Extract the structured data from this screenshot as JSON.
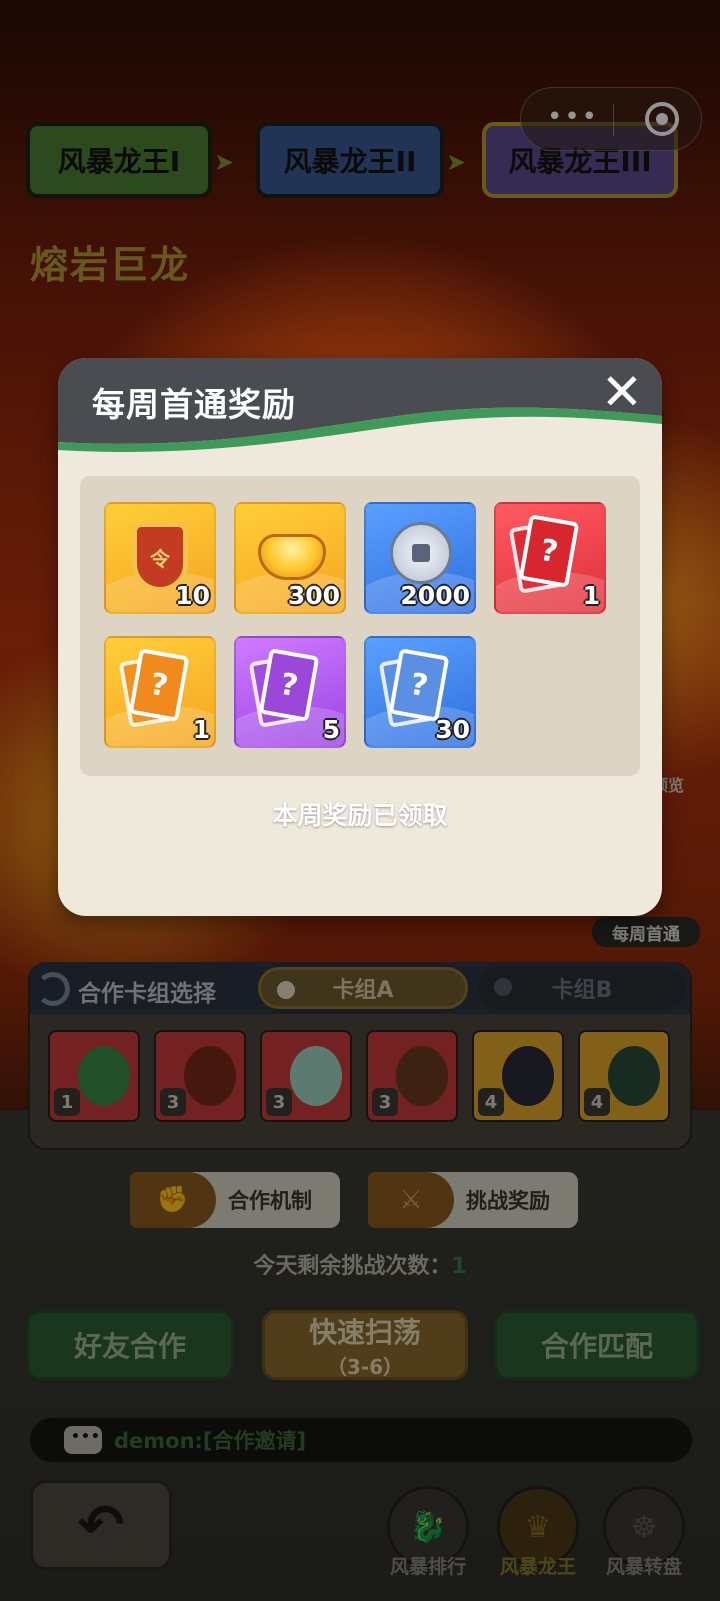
{
  "stages": [
    "风暴龙王I",
    "风暴龙王II",
    "风暴龙王III"
  ],
  "boss_name": "熔岩巨龙",
  "side": {
    "preview_label": "预览",
    "weekly_label": "每周首通"
  },
  "deck": {
    "title": "合作卡组选择",
    "tabs": [
      "卡组A",
      "卡组B"
    ],
    "selected_tab": "卡组A",
    "heroes": [
      {
        "level": "1"
      },
      {
        "level": "3"
      },
      {
        "level": "3"
      },
      {
        "level": "3"
      },
      {
        "level": "4"
      },
      {
        "level": "4"
      }
    ]
  },
  "mechanism_button": "合作机制",
  "challenge_reward_button": "挑战奖励",
  "remaining": {
    "label": "今天剩余挑战次数：",
    "count": "1"
  },
  "actions": {
    "friend": "好友合作",
    "sweep": "快速扫荡",
    "sweep_sub": "（3-6）",
    "match": "合作匹配"
  },
  "chat": {
    "text": "demon:[合作邀请]"
  },
  "nav": {
    "ranking": "风暴排行",
    "dragon_king": "风暴龙王",
    "wheel": "风暴转盘",
    "active": "风暴龙王"
  },
  "modal": {
    "title": "每周首通奖励",
    "close_icon": "close-icon",
    "rewards": [
      {
        "icon": "badge-icon",
        "count": "10",
        "bg": "#f5a51f"
      },
      {
        "icon": "gold-ingot-icon",
        "count": "300",
        "bg": "#f5a51f"
      },
      {
        "icon": "silver-coin-icon",
        "count": "2000",
        "bg": "#2f6fe0"
      },
      {
        "icon": "red-card-icon",
        "count": "1",
        "bg": "#e0303a"
      },
      {
        "icon": "orange-card-icon",
        "count": "1",
        "bg": "#f5a51f"
      },
      {
        "icon": "purple-card-icon",
        "count": "5",
        "bg": "#9a44e4"
      },
      {
        "icon": "blue-card-icon",
        "count": "30",
        "bg": "#2f6fe0"
      }
    ],
    "status": "本周奖励已领取"
  },
  "colors": {
    "modal_header": "#4a4c52",
    "modal_wave": "#3f9a5a",
    "modal_body": "#efe9dc"
  }
}
